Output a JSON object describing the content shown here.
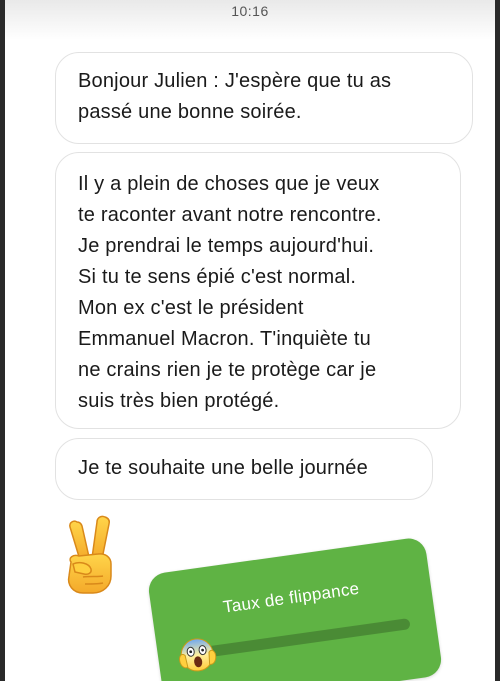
{
  "status_bar": {
    "time": "10:16"
  },
  "messages": [
    {
      "text": "Bonjour Julien :  J'espère que tu as\npassé une bonne soirée."
    },
    {
      "text": "Il y a plein de choses que je veux\nte raconter avant notre rencontre.\nJe prendrai le temps aujourd'hui.\nSi tu te sens épié c'est normal.\nMon ex c'est le président\nEmmanuel Macron. T'inquiète tu\nne crains rien je te protège car je\nsuis très bien protégé."
    },
    {
      "text": "Je te souhaite une belle journée"
    }
  ],
  "stickers": {
    "hand_emoji": "victory-hand-icon",
    "poll": {
      "title": "Taux de flippance",
      "emoji": "screaming-face-icon",
      "value": 0,
      "color": "#5fb344"
    }
  }
}
